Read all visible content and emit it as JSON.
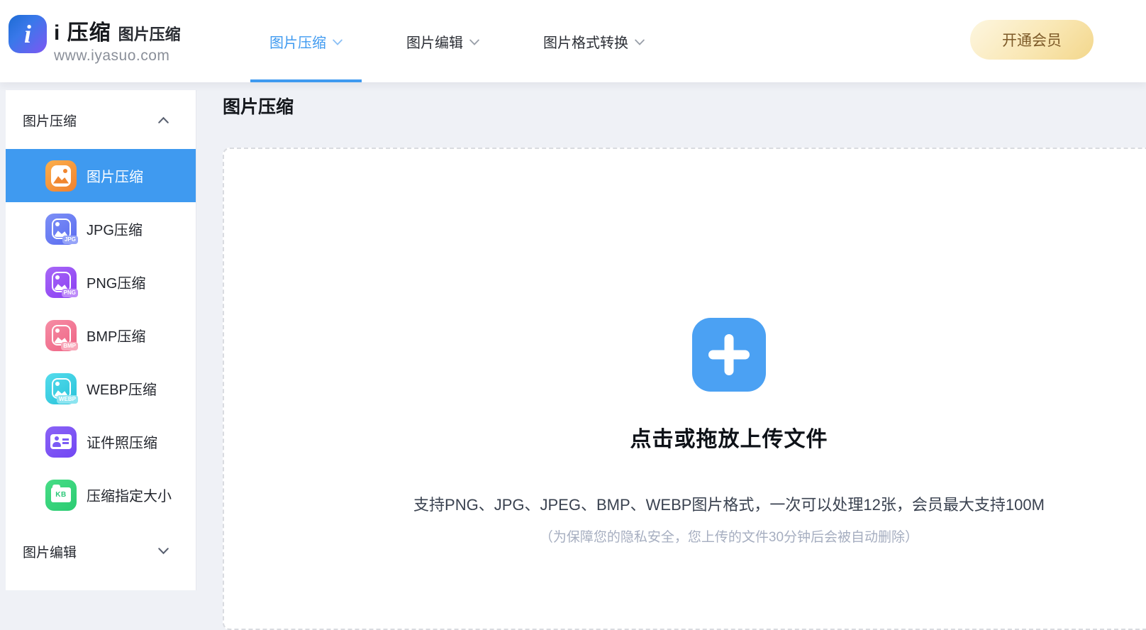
{
  "header": {
    "logo": {
      "icon_letter": "i",
      "title": "i 压缩",
      "product": "图片压缩",
      "url": "www.iyasuo.com"
    },
    "nav": [
      {
        "label": "图片压缩",
        "active": true
      },
      {
        "label": "图片编辑",
        "active": false
      },
      {
        "label": "图片格式转换",
        "active": false
      }
    ],
    "vip_button": "开通会员"
  },
  "sidebar": {
    "sections": [
      {
        "label": "图片压缩",
        "state": "expanded"
      },
      {
        "label": "图片编辑",
        "state": "collapsed"
      }
    ],
    "items": [
      {
        "label": "图片压缩",
        "badge": "",
        "color": "#f2913e",
        "active": true
      },
      {
        "label": "JPG压缩",
        "badge": "JPG",
        "color": "#6b7ef2",
        "active": false
      },
      {
        "label": "PNG压缩",
        "badge": "PNG",
        "color": "#9a55f2",
        "active": false
      },
      {
        "label": "BMP压缩",
        "badge": "BMP",
        "color": "#f27d96",
        "active": false
      },
      {
        "label": "WEBP压缩",
        "badge": "WEBP",
        "color": "#45cadd",
        "active": false
      },
      {
        "label": "证件照压缩",
        "badge": "",
        "color": "#7c5bf5",
        "active": false
      },
      {
        "label": "压缩指定大小",
        "badge": "KB",
        "color": "#3ed37f",
        "active": false
      }
    ]
  },
  "main": {
    "page_title": "图片压缩",
    "upload": {
      "title": "点击或拖放上传文件",
      "hint": "支持PNG、JPG、JPEG、BMP、WEBP图片格式，一次可以处理12张，会员最大支持100M",
      "note": "（为保障您的隐私安全，您上传的文件30分钟后会被自动删除）"
    }
  },
  "colors": {
    "accent_blue": "#3f9af0",
    "active_item_bg": "#3f9af0",
    "upload_plus": "#4ba1f3",
    "vip_text": "#7d5a28",
    "vip_bg_start": "#fdf5dd",
    "vip_bg_end": "#f3d78c"
  }
}
